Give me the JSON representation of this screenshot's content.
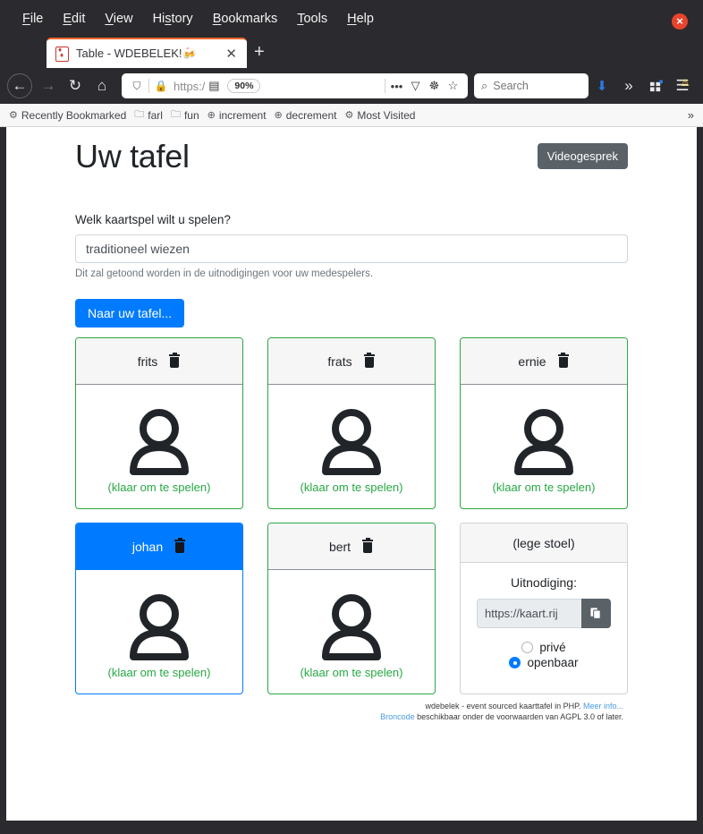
{
  "browser": {
    "menus": [
      {
        "pre": "",
        "key": "F",
        "post": "ile"
      },
      {
        "pre": "",
        "key": "E",
        "post": "dit"
      },
      {
        "pre": "",
        "key": "V",
        "post": "iew"
      },
      {
        "pre": "Hi",
        "key": "s",
        "post": "tory"
      },
      {
        "pre": "",
        "key": "B",
        "post": "ookmarks"
      },
      {
        "pre": "",
        "key": "T",
        "post": "ools"
      },
      {
        "pre": "",
        "key": "H",
        "post": "elp"
      }
    ],
    "close_label": "×",
    "tab": {
      "title": "Table - WDEBELEK!🍻",
      "close_label": "✕",
      "newtab_label": "+"
    },
    "nav": {
      "back": "←",
      "forward": "→",
      "reload": "↻",
      "home": "⌂",
      "shield": "⛉",
      "lock": "🔒",
      "url_text": "https:/",
      "reader": "▤",
      "zoom_level": "90%",
      "more": "•••",
      "pocket": "▽",
      "container": "☸",
      "bookmark_star": "☆",
      "search_icon": "⌕",
      "search_placeholder": "Search",
      "download": "⬇",
      "overflow": "»",
      "gift": "░",
      "hamburger": "☰",
      "warning": "⚠"
    },
    "bookmarks": [
      {
        "icon": "⚙",
        "label": "Recently Bookmarked"
      },
      {
        "icon": "🗀",
        "label": "farl"
      },
      {
        "icon": "🗀",
        "label": "fun"
      },
      {
        "icon": "⊕",
        "label": "increment"
      },
      {
        "icon": "⊕",
        "label": "decrement"
      },
      {
        "icon": "⚙",
        "label": "Most Visited"
      }
    ],
    "bookmarks_overflow": "»"
  },
  "page": {
    "title": "Uw tafel",
    "video_button": "Videogesprek",
    "form": {
      "label": "Welk kaartspel wilt u spelen?",
      "value": "traditioneel wiezen",
      "placeholder": "",
      "help": "Dit zal getoond worden in de uitnodigingen voor uw medespelers."
    },
    "table_button": "Naar uw tafel...",
    "seats": [
      {
        "name": "frits",
        "state": "occupied",
        "status": "(klaar om te spelen)",
        "trash": "delete-icon"
      },
      {
        "name": "frats",
        "state": "occupied",
        "status": "(klaar om te spelen)",
        "trash": "delete-icon"
      },
      {
        "name": "ernie",
        "state": "occupied",
        "status": "(klaar om te spelen)",
        "trash": "delete-icon"
      },
      {
        "name": "johan",
        "state": "occupied-self",
        "status": "(klaar om te spelen)",
        "trash": "delete-icon"
      },
      {
        "name": "bert",
        "state": "occupied",
        "status": "(klaar om te spelen)",
        "trash": "delete-icon"
      },
      {
        "name": "(lege stoel)",
        "state": "empty"
      }
    ],
    "empty_seat": {
      "invite_label": "Uitnodiging:",
      "invite_url": "https://kaart.rij",
      "copy_icon": "copy-icon",
      "options": [
        {
          "label": "privé",
          "checked": false
        },
        {
          "label": "openbaar",
          "checked": true
        }
      ]
    },
    "footer": {
      "line1_text": "wdebelek - event sourced kaarttafel in PHP. ",
      "line1_link": "Meer info...",
      "line2_link": "Broncode",
      "line2_text": " beschikbaar onder de voorwaarden van AGPL 3.0 of later."
    }
  },
  "colors": {
    "accent_blue": "#007bff",
    "ready_green": "#28a745",
    "gray_button": "#5a6268",
    "tab_accent": "#f1662a"
  }
}
